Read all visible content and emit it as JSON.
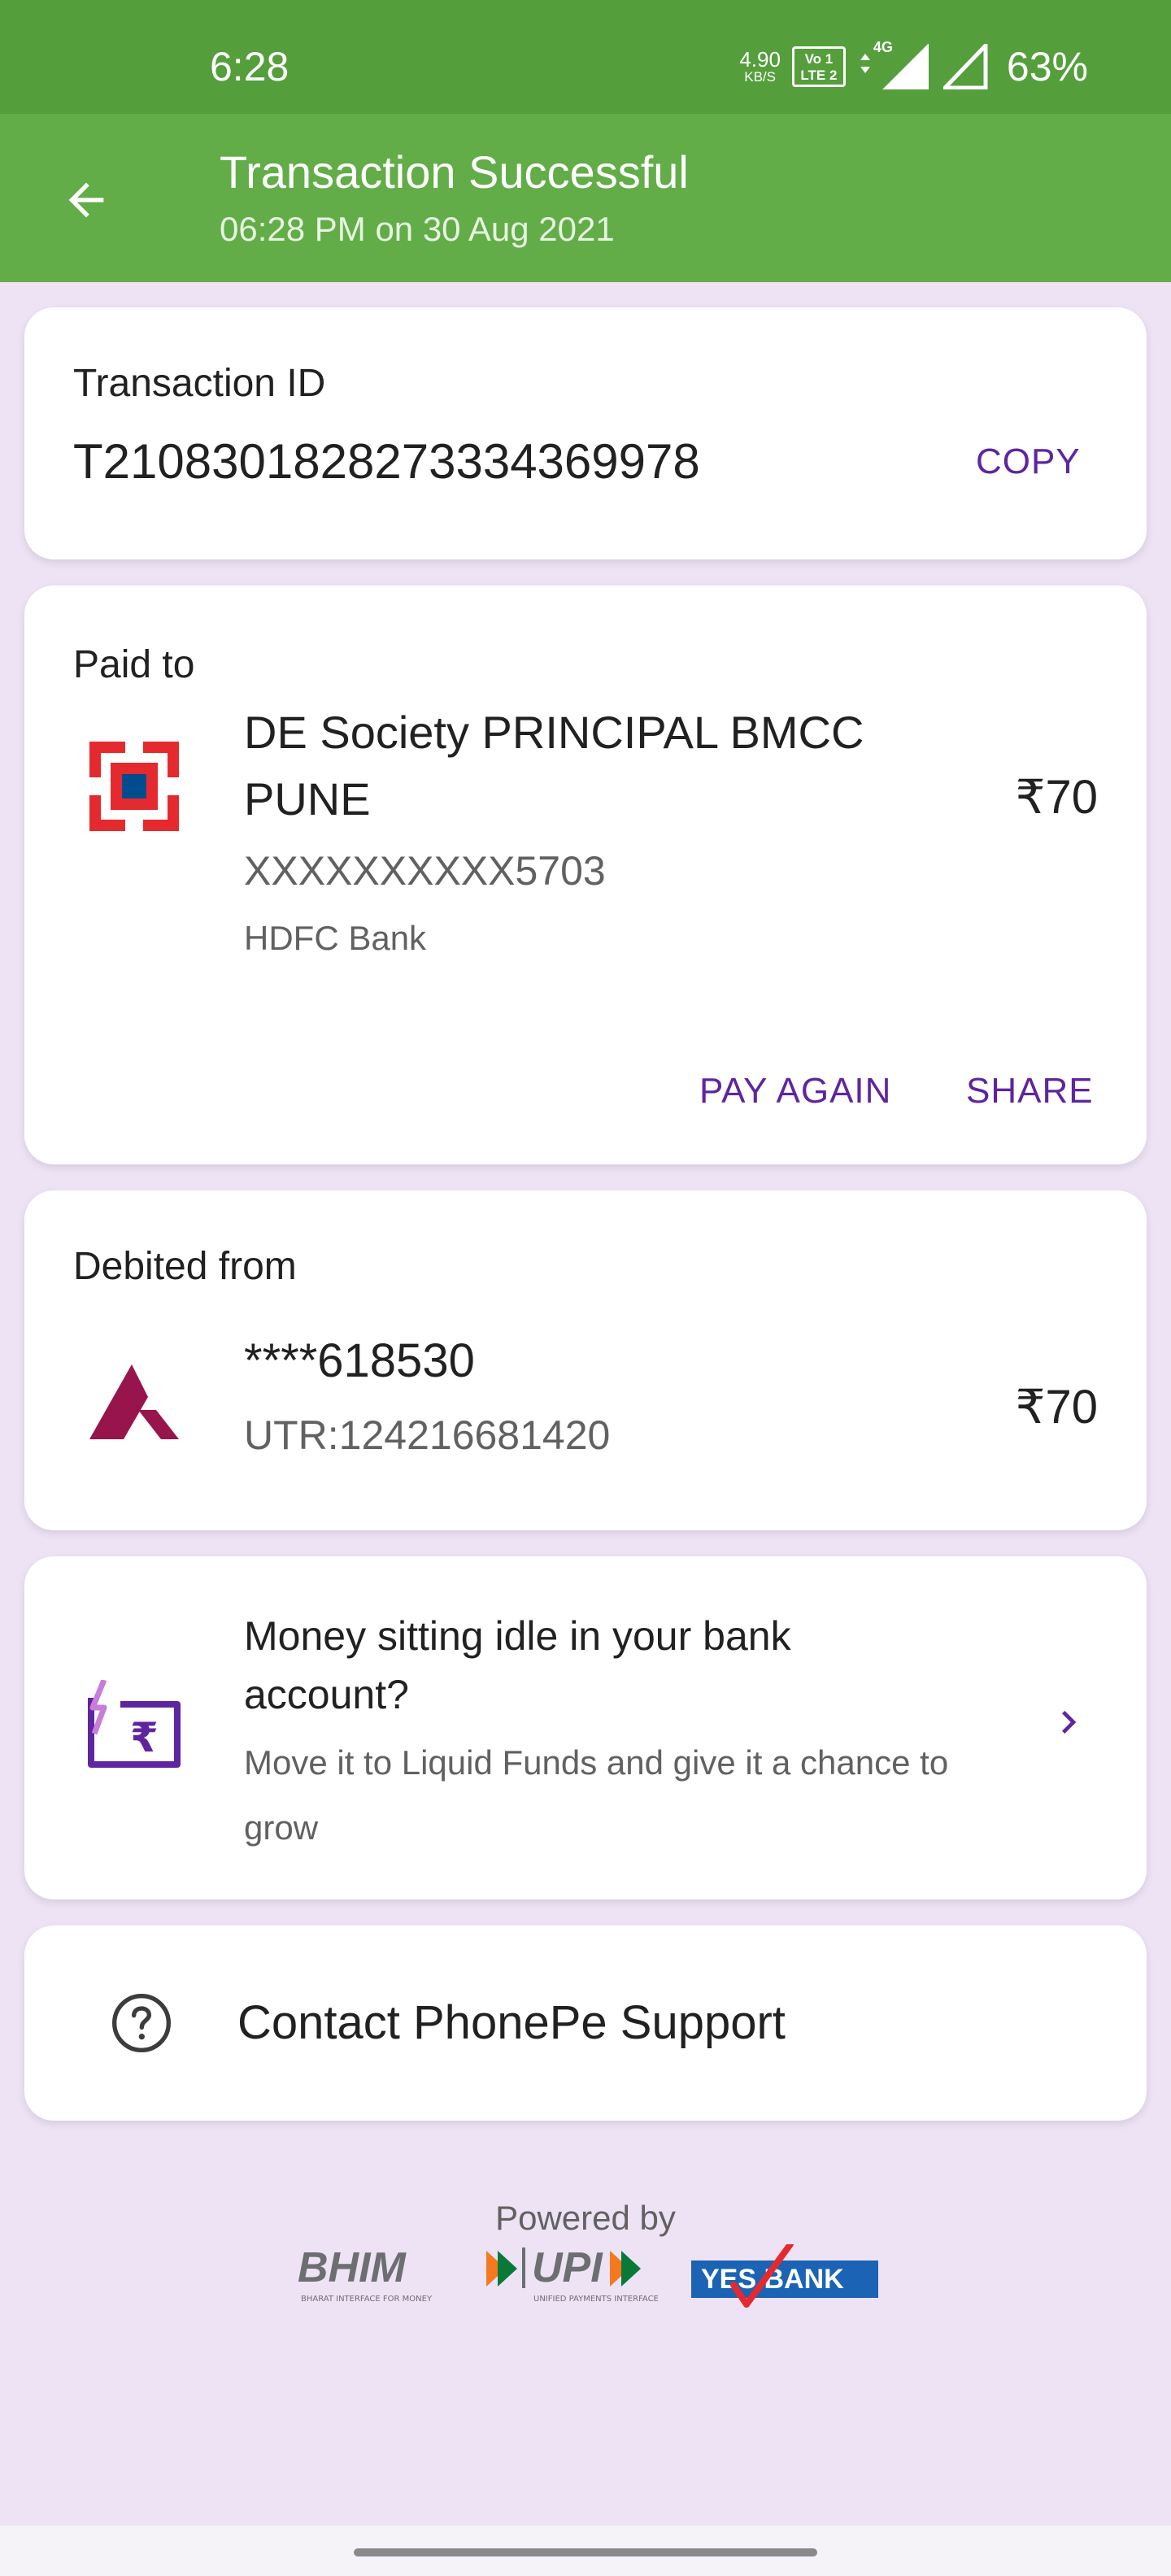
{
  "status_bar": {
    "time": "6:28",
    "net_speed": "4.90",
    "net_unit": "KB/S",
    "volte_line1": "Vo 1",
    "volte_line2": "LTE 2",
    "network": "4G",
    "battery": "63%"
  },
  "app_bar": {
    "title": "Transaction Successful",
    "subtitle": "06:28 PM on 30 Aug 2021",
    "back_icon": "arrow-left-icon"
  },
  "transaction": {
    "label": "Transaction ID",
    "id": "T2108301828273334369978",
    "copy_label": "COPY"
  },
  "paid_to": {
    "label": "Paid to",
    "name_line1": "DE Society PRINCIPAL BMCC",
    "name_line2": "PUNE",
    "account": "XXXXXXXXXX5703",
    "bank": "HDFC Bank",
    "amount": "₹70",
    "pay_again_label": "PAY AGAIN",
    "share_label": "SHARE",
    "bank_icon": "hdfc-logo-icon"
  },
  "debited_from": {
    "label": "Debited from",
    "account": "****618530",
    "utr": "UTR:124216681420",
    "amount": "₹70",
    "bank_icon": "axis-logo-icon"
  },
  "promo": {
    "title_line1": "Money sitting idle in your bank",
    "title_line2": "account?",
    "body_line1": "Move it to Liquid Funds and give it a chance to",
    "body_line2": "grow",
    "icon": "rupee-wallet-icon"
  },
  "support": {
    "label": "Contact PhonePe Support",
    "icon": "question-circle-icon"
  },
  "footer": {
    "powered_by": "Powered by",
    "bhim": "BHIM",
    "bhim_tag": "BHARAT INTERFACE FOR MONEY",
    "upi": "UPI",
    "upi_tag": "UNIFIED PAYMENTS INTERFACE",
    "yes_bank": "YES BANK"
  },
  "colors": {
    "status_green": "#559e3c",
    "appbar_green": "#62ad48",
    "purple": "#5f259f",
    "background": "#ede3f5"
  }
}
